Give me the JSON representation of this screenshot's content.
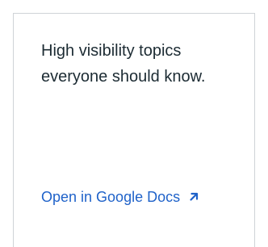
{
  "card": {
    "text": "High visibility topics everyone should know.",
    "link_label": "Open in Google Docs",
    "link_icon": "arrow-up-right-icon",
    "link_color": "#1f62c9",
    "text_color": "#1c2b33",
    "border_color": "#cfd3d7"
  }
}
